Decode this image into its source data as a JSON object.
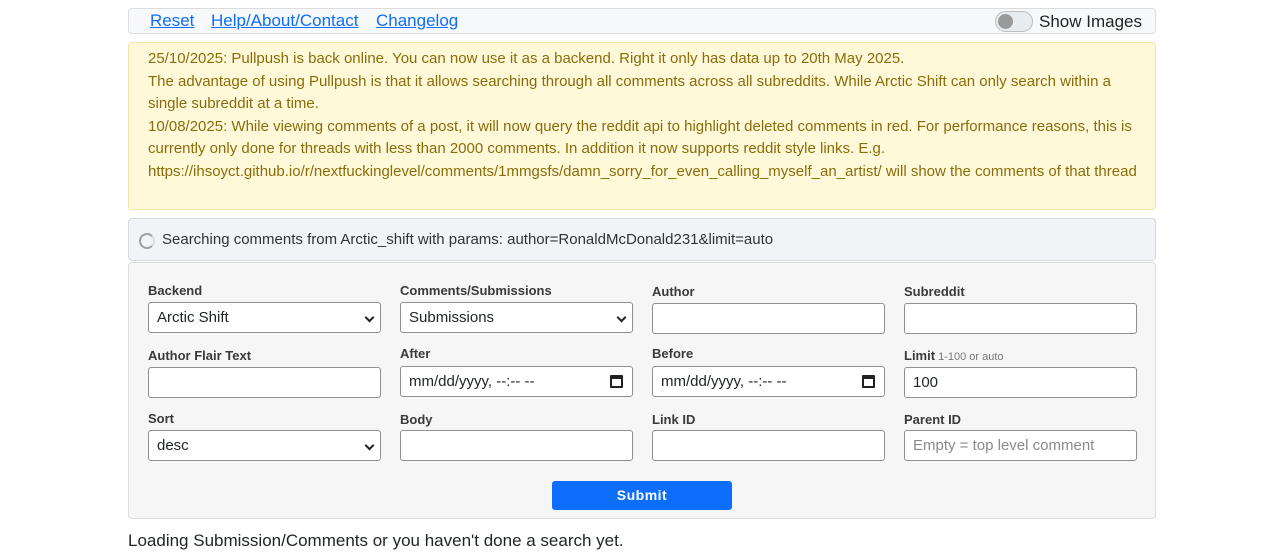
{
  "nav": {
    "reset": "Reset",
    "help": "Help/About/Contact",
    "changelog": "Changelog",
    "show_images": "Show Images",
    "show_images_on": false
  },
  "notice": {
    "line1": "25/10/2025: Pullpush is back online. You can now use it as a backend. Right it only has data up to 20th May 2025.",
    "line2": "The advantage of using Pullpush is that it allows searching through all comments across all subreddits. While Arctic Shift can only search within a single subreddit at a time.",
    "line3": "10/08/2025: While viewing comments of a post, it will now query the reddit api to highlight deleted comments in red. For performance reasons, this is currently only done for threads with less than 2000 comments. In addition it now supports reddit style links. E.g. https://ihsoyct.github.io/r/nextfuckinglevel/comments/1mmgsfs/damn_sorry_for_even_calling_myself_an_artist/ will show the comments of that thread"
  },
  "status": {
    "text": "Searching comments from Arctic_shift with params: author=RonaldMcDonald231&limit=auto"
  },
  "form": {
    "backend": {
      "label": "Backend",
      "value": "Arctic Shift"
    },
    "type": {
      "label": "Comments/Submissions",
      "value": "Submissions"
    },
    "author": {
      "label": "Author",
      "value": ""
    },
    "subreddit": {
      "label": "Subreddit",
      "value": ""
    },
    "flair": {
      "label": "Author Flair Text",
      "value": ""
    },
    "after": {
      "label": "After",
      "value": "mm/dd/yyyy, --:-- --"
    },
    "before": {
      "label": "Before",
      "value": "mm/dd/yyyy, --:-- --"
    },
    "limit": {
      "label": "Limit",
      "hint": "1-100 or auto",
      "value": "100"
    },
    "sort": {
      "label": "Sort",
      "value": "desc"
    },
    "body": {
      "label": "Body",
      "value": ""
    },
    "link_id": {
      "label": "Link ID",
      "value": ""
    },
    "parent_id": {
      "label": "Parent ID",
      "placeholder": "Empty = top level comment"
    },
    "submit": "Submit"
  },
  "footer": {
    "text": "Loading Submission/Comments or you haven't done a search yet."
  }
}
